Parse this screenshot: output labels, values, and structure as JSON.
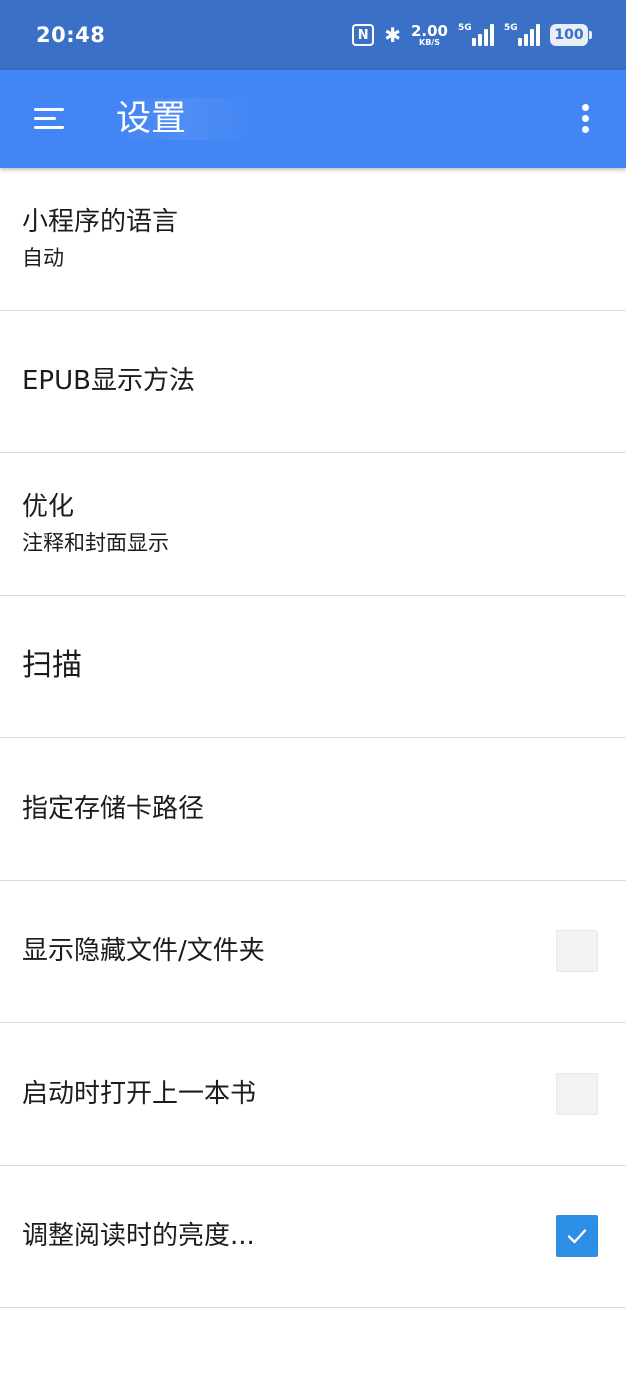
{
  "status_bar": {
    "time": "20:48",
    "nfc_label": "N",
    "bluetooth_glyph": "✱",
    "net_speed_value": "2.00",
    "net_speed_unit": "KB/S",
    "signal1_tag": "5G",
    "signal2_tag": "5G",
    "battery": "100"
  },
  "app_bar": {
    "title": "设置"
  },
  "settings": [
    {
      "title": "小程序的语言",
      "subtitle": "自动"
    },
    {
      "title": "EPUB显示方法"
    },
    {
      "title": "优化",
      "subtitle": "注释和封面显示"
    },
    {
      "title": "扫描"
    },
    {
      "title": "指定存储卡路径"
    },
    {
      "title": "显示隐藏文件/文件夹",
      "checked": false
    },
    {
      "title": "启动时打开上一本书",
      "checked": false
    },
    {
      "title": "调整阅读时的亮度...",
      "checked": true
    }
  ],
  "colors": {
    "status_bar_bg": "#3a70c5",
    "app_bar_bg": "#4285f4",
    "checkbox_checked": "#2d8ee5"
  },
  "icons": {
    "menu": "hamburger-icon",
    "overflow": "more-vert-icon",
    "check": "check-icon",
    "nfc": "nfc-icon",
    "bluetooth": "bluetooth-icon",
    "signal": "signal-icon",
    "battery": "battery-icon"
  }
}
